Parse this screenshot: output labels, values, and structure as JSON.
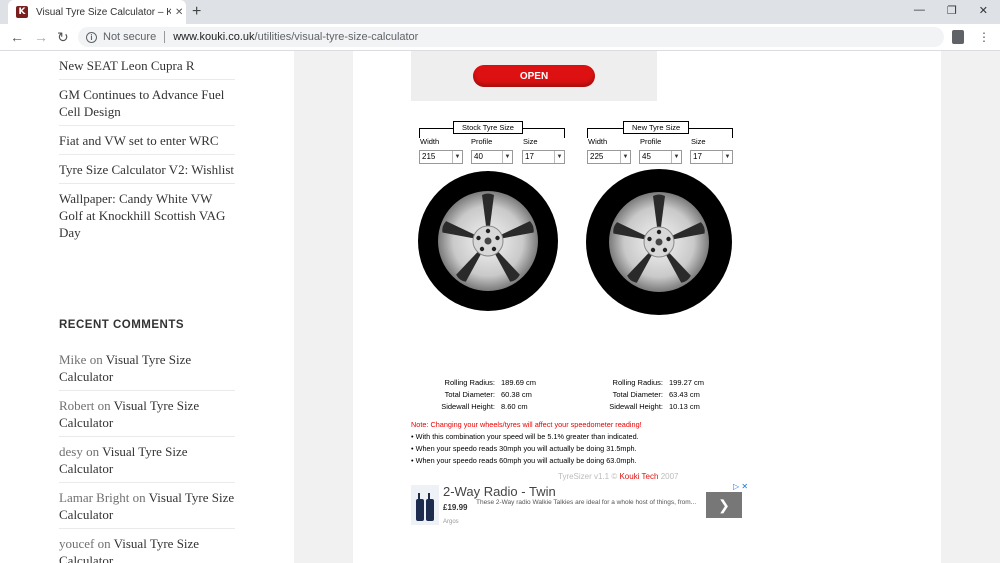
{
  "browser": {
    "tab_title": "Visual Tyre Size Calculator – Ko",
    "tab_icon_letter": "K",
    "tab_close": "✕",
    "new_tab": "+",
    "not_secure": "Not secure",
    "url_host": "www.kouki.co.uk",
    "url_path": "/utilities/visual-tyre-size-calculator"
  },
  "sidebar": {
    "recent_posts": [
      "New SEAT Leon Cupra R",
      "GM Continues to Advance Fuel Cell Design",
      "Fiat and VW set to enter WRC",
      "Tyre Size Calculator V2: Wishlist",
      "Wallpaper: Candy White VW Golf at Knockhill Scottish VAG Day"
    ],
    "comments_heading": "RECENT COMMENTS",
    "comments": [
      {
        "author": "Mike",
        "on": " on ",
        "post": "Visual Tyre Size Calculator"
      },
      {
        "author": "Robert",
        "on": " on ",
        "post": "Visual Tyre Size Calculator"
      },
      {
        "author": "desy",
        "on": " on ",
        "post": "Visual Tyre Size Calculator"
      },
      {
        "author": "Lamar Bright",
        "on": " on ",
        "post": "Visual Tyre Size Calculator"
      },
      {
        "author": "youcef",
        "on": " on ",
        "post": "Visual Tyre Size Calculator"
      }
    ]
  },
  "open_button": "OPEN",
  "calculator": {
    "stock": {
      "title": "Stock Tyre Size",
      "labels": [
        "Width",
        "Profile",
        "Size"
      ],
      "values": [
        "215",
        "40",
        "17"
      ],
      "rolling_radius_label": "Rolling Radius:",
      "rolling_radius": "189.69 cm",
      "total_diameter_label": "Total Diameter:",
      "total_diameter": "60.38 cm",
      "sidewall_label": "Sidewall Height:",
      "sidewall": "8.60 cm"
    },
    "new": {
      "title": "New Tyre Size",
      "labels": [
        "Width",
        "Profile",
        "Size"
      ],
      "values": [
        "225",
        "45",
        "17"
      ],
      "rolling_radius_label": "Rolling Radius:",
      "rolling_radius": "199.27 cm",
      "total_diameter_label": "Total Diameter:",
      "total_diameter": "63.43 cm",
      "sidewall_label": "Sidewall Height:",
      "sidewall": "10.13 cm"
    },
    "note_warning": "Note: Changing your wheels/tyres will affect your speedometer reading!",
    "note_lines": [
      "• With this combination your speed will be 5.1% greater than indicated.",
      "• When your speedo reads 30mph you will actually be doing 31.5mph.",
      "• When your speedo reads 60mph you will actually be doing 63.0mph."
    ],
    "credit_prefix": "TyreSizer v1.1 © ",
    "credit_link": "Kouki Tech",
    "credit_suffix": " 2007"
  },
  "ad": {
    "title": "2-Way Radio - Twin",
    "price": "£19.99",
    "text": "These 2-Way radio Walkie Talkies are ideal for a whole host of things, from...",
    "brand": "Argos",
    "choices": "▷ ✕"
  },
  "colors": {
    "accent": "#dd1111",
    "tab_bar": "#dee1e6"
  }
}
